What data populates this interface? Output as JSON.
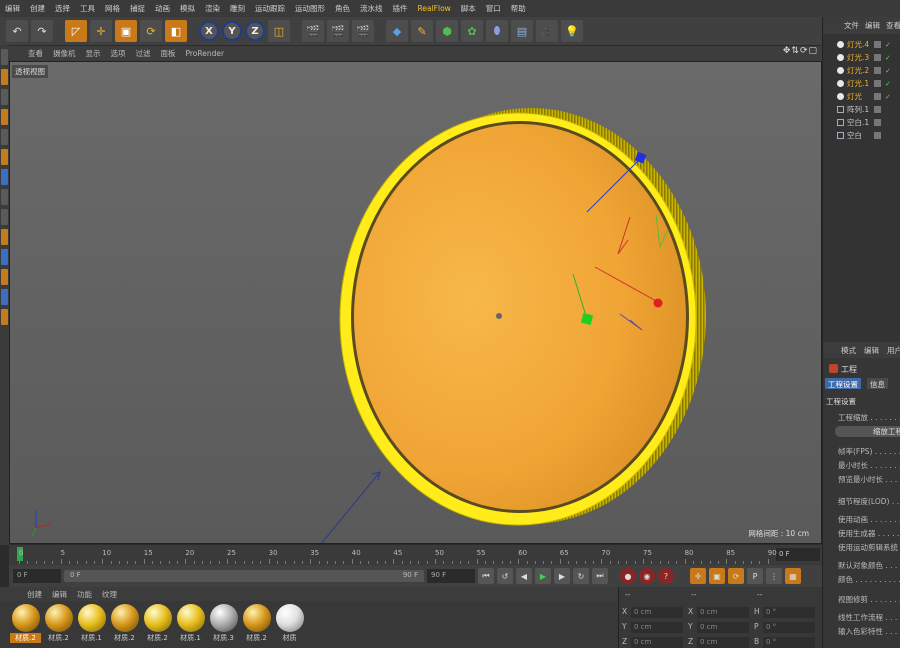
{
  "menubar": {
    "items": [
      "编辑",
      "创建",
      "选择",
      "工具",
      "网格",
      "捕捉",
      "动画",
      "模拟",
      "渲染",
      "雕刻",
      "运动跟踪",
      "运动图形",
      "角色",
      "流水线",
      "插件",
      "RealFlow",
      "脚本",
      "窗口",
      "帮助"
    ],
    "accent_item": "RealFlow"
  },
  "toolbar": {
    "axis_x": "X",
    "axis_y": "Y",
    "axis_z": "Z"
  },
  "viewport": {
    "menu": [
      "查看",
      "摄像机",
      "显示",
      "选项",
      "过滤",
      "面板",
      "ProRender"
    ],
    "label": "透视视图",
    "grid_distance": "网格间距 : 10 cm",
    "nav_icons": "✥⇅⟳▢"
  },
  "timeline": {
    "ticks": [
      "0",
      "5",
      "10",
      "15",
      "20",
      "25",
      "30",
      "35",
      "40",
      "45",
      "50",
      "55",
      "60",
      "65",
      "70",
      "75",
      "80",
      "85",
      "90"
    ],
    "frame_field": "0 F"
  },
  "transport": {
    "start": "0 F",
    "slider_start": "0 F",
    "slider_end": "90 F",
    "end": "90 F"
  },
  "materials": {
    "menu": [
      "创建",
      "编辑",
      "功能",
      "纹理"
    ],
    "items": [
      {
        "label": "材质.2",
        "color": "gold",
        "selected": true
      },
      {
        "label": "材质.2",
        "color": "gold",
        "selected": false
      },
      {
        "label": "材质.1",
        "color": "yellow",
        "selected": false
      },
      {
        "label": "材质.2",
        "color": "gold",
        "selected": false
      },
      {
        "label": "材质.2",
        "color": "yellow",
        "selected": false
      },
      {
        "label": "材质.1",
        "color": "yellow",
        "selected": false
      },
      {
        "label": "材质.3",
        "color": "silver",
        "selected": false
      },
      {
        "label": "材质.2",
        "color": "gold",
        "selected": false
      },
      {
        "label": "材质",
        "color": "white",
        "selected": false
      }
    ]
  },
  "coords": {
    "header1": "--",
    "header2": "--",
    "header3": "--",
    "x_label": "X",
    "y_label": "Y",
    "z_label": "Z",
    "x_pos": "0 cm",
    "y_pos": "0 cm",
    "z_pos": "0 cm",
    "x_size": "0 cm",
    "y_size": "0 cm",
    "z_size": "0 cm",
    "h_label": "H",
    "p_label": "P",
    "b_label": "B",
    "h_val": "0 °",
    "p_val": "0 °",
    "b_val": "0 °"
  },
  "object_manager": {
    "menu": [
      "文件",
      "编辑",
      "查看"
    ],
    "objects": [
      {
        "name": "灯光.4",
        "type": "light"
      },
      {
        "name": "灯光.3",
        "type": "light"
      },
      {
        "name": "灯光.2",
        "type": "light"
      },
      {
        "name": "灯光.1",
        "type": "light"
      },
      {
        "name": "灯光",
        "type": "light"
      },
      {
        "name": "阵列.1",
        "type": "array"
      },
      {
        "name": "空白.1",
        "type": "null"
      },
      {
        "name": "空白",
        "type": "null"
      }
    ]
  },
  "attribute_manager": {
    "menu": [
      "模式",
      "编辑",
      "用户"
    ],
    "title": "工程",
    "tab_active": "工程设置",
    "tab_info": "信息",
    "section": "工程设置",
    "lines": [
      "工程缩放 . . . . . . .",
      "帧率(FPS) . . . . . .",
      "最小时长 . . . . . . .",
      "预览最小时长 . . . .",
      "细节程度(LOD) . . .",
      "使用动画 . . . . . . .",
      "使用生成器 . . . . . .",
      "使用运动剪辑系统 .",
      "默认对象颜色 . . . .",
      "颜色 . . . . . . . . . . .",
      "视图修剪 . . . . . . .",
      "线性工作流程 . . . .",
      "输入色彩特性 . . . ."
    ],
    "button": "缩放工程"
  },
  "colors": {
    "accent": "#c8791a",
    "light_text": "#f0b030",
    "coin_face": "#f2a93a",
    "coin_rim": "#ffec1a"
  }
}
